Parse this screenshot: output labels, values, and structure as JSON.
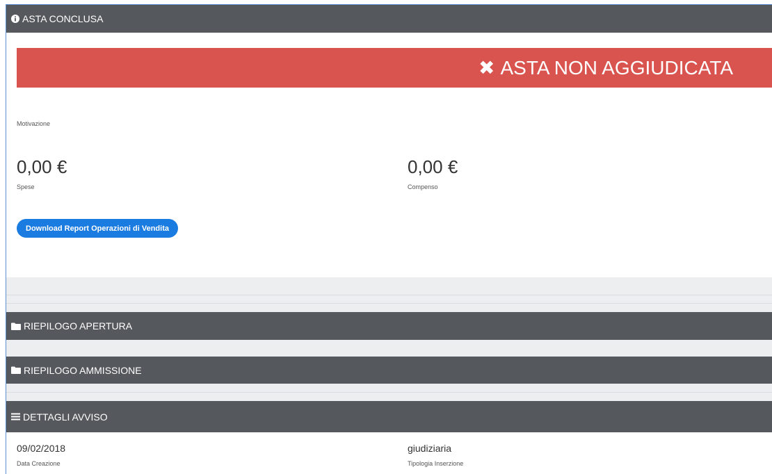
{
  "header_asta": {
    "title": "ASTA CONCLUSA",
    "icon": "info-circle-icon"
  },
  "alert": {
    "icon": "close-icon",
    "text": "ASTA NON AGGIUDICATA",
    "color": "#d9534f"
  },
  "motivazione": {
    "label": "Motivazione"
  },
  "spese": {
    "value": "0,00 €",
    "label": "Spese"
  },
  "compenso": {
    "value": "0,00 €",
    "label": "Compenso"
  },
  "download_button": {
    "label": "Download Report Operazioni di Vendita",
    "color": "#1a7be0"
  },
  "riepilogo_apertura": {
    "title": "RIEPILOGO APERTURA",
    "icon": "folder-icon"
  },
  "riepilogo_ammissione": {
    "title": "RIEPILOGO AMMISSIONE",
    "icon": "folder-icon"
  },
  "dettagli_avviso": {
    "title": "DETTAGLI AVVISO",
    "icon": "menu-icon",
    "data_creazione": {
      "value": "09/02/2018",
      "label": "Data Creazione"
    },
    "tipologia_inserzione": {
      "value": "giudiziaria",
      "label": "Tipologia Inserzione"
    }
  },
  "colors": {
    "panel_header": "#55585c",
    "band": "#eceef0"
  }
}
